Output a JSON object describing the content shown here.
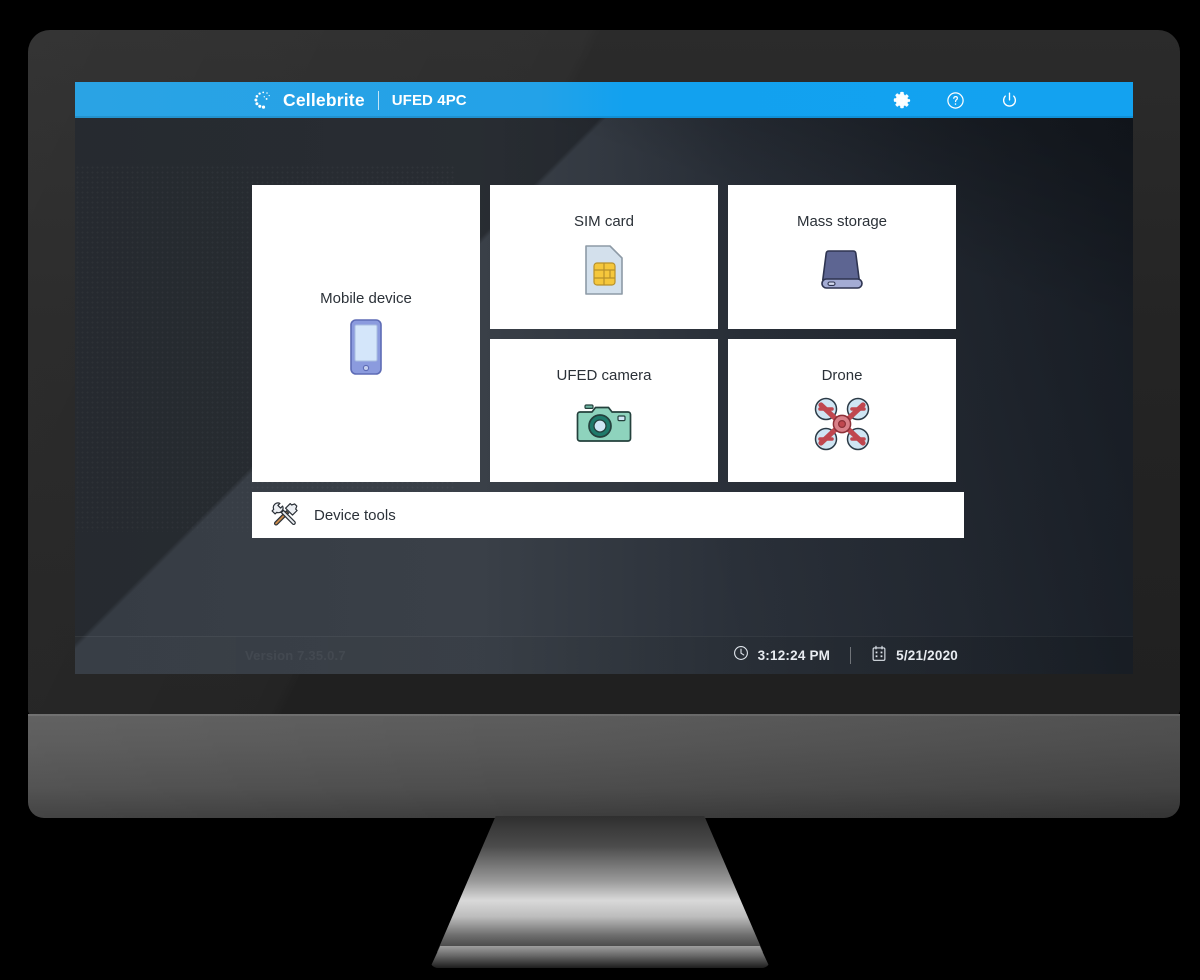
{
  "app": {
    "brand_name": "Cellebrite",
    "product_name": "UFED 4PC",
    "logo_icon": "cellebrite-dots-logo-icon",
    "accent_color": "#14a2ef",
    "screen_bg_color": "#333940",
    "tile_bg_color": "#ffffff",
    "tile_text_color": "#2b3138"
  },
  "titlebar": {
    "actions": [
      {
        "name": "settings",
        "label": "Settings",
        "icon": "gear-icon"
      },
      {
        "name": "help",
        "label": "Help",
        "icon": "question-circle-icon"
      },
      {
        "name": "power",
        "label": "Power",
        "icon": "power-icon"
      }
    ]
  },
  "main": {
    "tiles": [
      {
        "id": "mobile-device",
        "label": "Mobile device",
        "icon": "smartphone-icon"
      },
      {
        "id": "sim-card",
        "label": "SIM card",
        "icon": "sim-card-icon"
      },
      {
        "id": "mass-storage",
        "label": "Mass storage",
        "icon": "hard-drive-icon"
      },
      {
        "id": "ufed-camera",
        "label": "UFED camera",
        "icon": "camera-icon"
      },
      {
        "id": "drone",
        "label": "Drone",
        "icon": "quadcopter-drone-icon"
      }
    ],
    "device_tools": {
      "label": "Device tools",
      "icon": "hammer-wrench-icon"
    }
  },
  "statusbar": {
    "time": "3:12:24 PM",
    "date": "5/21/2020",
    "time_icon": "clock-icon",
    "date_icon": "calendar-icon",
    "version": "Version 7.35.0.7"
  }
}
